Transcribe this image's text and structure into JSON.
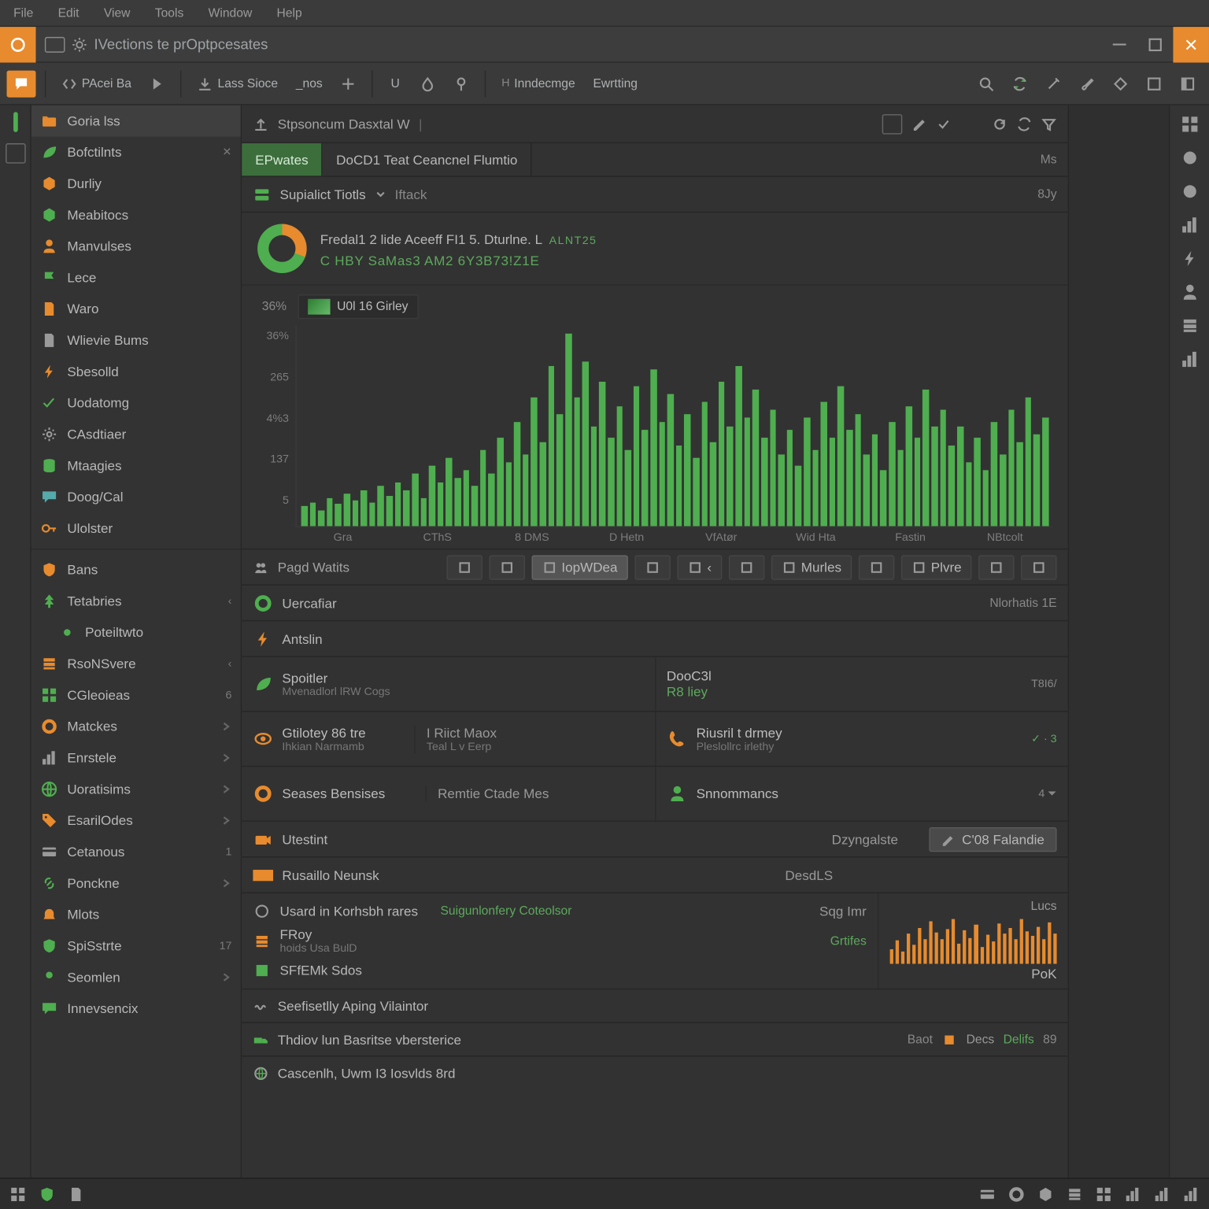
{
  "menubar": [
    "File",
    "Edit",
    "View",
    "Tools",
    "Window",
    "Help"
  ],
  "title": {
    "text": "IVections te prOptpcesates"
  },
  "toolbar": {
    "left": [
      {
        "icon": "bubble",
        "label": ""
      },
      {
        "icon": "code",
        "label": "PAcei Ba"
      },
      {
        "icon": "play",
        "label": ""
      }
    ],
    "mid": [
      {
        "icon": "download",
        "label": "Lass Sioce"
      },
      {
        "icon": "line",
        "label": "_nos"
      },
      {
        "icon": "plus",
        "label": ""
      }
    ],
    "mid2": [
      {
        "icon": "u",
        "label": "U"
      },
      {
        "icon": "drop",
        "label": ""
      },
      {
        "icon": "pin",
        "label": ""
      }
    ],
    "mid3": [
      {
        "label": "Inndecmge"
      },
      {
        "label": "Ewrtting"
      }
    ],
    "right": [
      "search",
      "sync",
      "wand",
      "brush",
      "diamond",
      "box",
      "panel"
    ]
  },
  "sidebar": [
    {
      "icon": "folder-o",
      "label": "Goria lss",
      "color": "c-orange",
      "active": true
    },
    {
      "icon": "leaf",
      "label": "Bofctilnts",
      "color": "c-green",
      "badge": "✕"
    },
    {
      "icon": "cube-o",
      "label": "Durliy",
      "color": "c-orange"
    },
    {
      "icon": "cube-g",
      "label": "Meabitocs",
      "color": "c-green"
    },
    {
      "icon": "person",
      "label": "Manvulses",
      "color": "c-orange"
    },
    {
      "icon": "flag",
      "label": "Lece",
      "color": "c-green"
    },
    {
      "icon": "doc-o",
      "label": "Waro",
      "color": "c-orange"
    },
    {
      "icon": "doc",
      "label": "Wlievie Bums",
      "color": "c-grey"
    },
    {
      "icon": "bolt",
      "label": "Sbesolld",
      "color": "c-orange"
    },
    {
      "icon": "check",
      "label": "Uodatomg",
      "color": "c-green"
    },
    {
      "icon": "gear",
      "label": "CAsdtiaer",
      "color": "c-grey"
    },
    {
      "icon": "db",
      "label": "Mtaagies",
      "color": "c-green"
    },
    {
      "icon": "chat",
      "label": "Doog/Cal",
      "color": "c-teal"
    },
    {
      "icon": "key",
      "label": "Ulolster",
      "color": "c-orange"
    },
    {
      "sep": true
    },
    {
      "icon": "shield-o",
      "label": "Bans",
      "color": "c-orange"
    },
    {
      "icon": "tree",
      "label": "Tetabries",
      "color": "c-green",
      "badge": "‹"
    },
    {
      "icon": "dot-g",
      "label": "Poteiltwto",
      "color": "c-green",
      "indent": true
    },
    {
      "icon": "stack",
      "label": "RsoNSvere",
      "color": "c-orange",
      "badge": "‹"
    },
    {
      "icon": "grid",
      "label": "CGleoieas",
      "color": "c-green",
      "badge": "6"
    },
    {
      "icon": "ring",
      "label": "Matckes",
      "color": "c-orange",
      "chev": true
    },
    {
      "icon": "bars",
      "label": "Enrstele",
      "color": "c-grey",
      "chev": true
    },
    {
      "icon": "globe-g",
      "label": "Uoratisims",
      "color": "c-green",
      "chev": true
    },
    {
      "icon": "tag",
      "label": "EsarilOdes",
      "color": "c-orange",
      "chev": true
    },
    {
      "icon": "card",
      "label": "Cetanous",
      "color": "c-grey",
      "badge": "1"
    },
    {
      "icon": "link",
      "label": "Ponckne",
      "color": "c-green",
      "chev": true
    },
    {
      "icon": "bell-o",
      "label": "Mlots",
      "color": "c-orange"
    },
    {
      "icon": "shield-g",
      "label": "SpiSstrte",
      "color": "c-green",
      "badge": "17"
    },
    {
      "icon": "pin-g",
      "label": "Seomlen",
      "color": "c-green",
      "chev": true
    },
    {
      "icon": "bubble-g",
      "label": "Innevsencix",
      "color": "c-green"
    }
  ],
  "rail_right": [
    "grid",
    "download",
    "export",
    "chart-dot",
    "bug",
    "person",
    "layers",
    "ruler"
  ],
  "content": {
    "head": {
      "title": "Stpsoncum Dasxtal W",
      "actions": [
        "box",
        "pen",
        "check",
        "refresh",
        "sync",
        "filter"
      ]
    },
    "tabs": [
      {
        "label": "EPwates",
        "active": true
      },
      {
        "label": "DoCD1 Teat Ceancnel Flumtio"
      }
    ],
    "tab_meta": "Ms",
    "panel_head": {
      "icon": "server",
      "label": "Supialict Tiotls",
      "sub": "Iftack",
      "meta": "8Jy"
    },
    "titleblock": {
      "title": "Fredal1 2 lide Aceeff FI1 5. Dturlne. L",
      "tag": "ALNT25",
      "sub": "C HBY SaMas3 AM2 6Y3B73!Z1E"
    },
    "legend": {
      "label": "U0l 16 Girley"
    },
    "y_top": "36%",
    "action_bar": {
      "left": {
        "icon": "users",
        "label": "Pagd Watits"
      },
      "buttons": [
        {
          "icon": "note",
          "label": ""
        },
        {
          "icon": "thumb",
          "label": ""
        },
        {
          "icon": "label",
          "label": "IopWDea",
          "primary": true
        },
        {
          "icon": "ring",
          "label": ""
        },
        {
          "icon": "back",
          "label": "‹"
        },
        {
          "icon": "box",
          "label": ""
        },
        {
          "icon": "flame",
          "label": "Murles"
        },
        {
          "icon": "tab",
          "label": ""
        },
        {
          "icon": "tag",
          "label": "Plvre"
        },
        {
          "icon": "eq",
          "label": ""
        },
        {
          "icon": "grid",
          "label": ""
        }
      ]
    },
    "rows": [
      {
        "icon": "ring-g",
        "t": "Uercafiar",
        "meta": "Nlorhatis 1E"
      },
      {
        "icon": "bolt-o",
        "t": "Antslin"
      }
    ],
    "grid": [
      [
        {
          "icon": "leaf-g",
          "t1": "Spoitler",
          "t2": "Mvenadlorl lRW Cogs"
        },
        {
          "t1": "DooC3l",
          "t2": "R8 liey",
          "t2c": "green",
          "badge": "T8I6/"
        }
      ],
      [
        {
          "icon": "eye-o",
          "t1": "Gtilotey 86 tre",
          "t2": "Ihkian Narmamb",
          "mid": "I Riict Maox",
          "mid2": "Teal L v Eerp"
        },
        {
          "icon": "phone-o",
          "t1": "Riusril t drmey",
          "t2": "Pleslollrc irlethy",
          "badge": "✓  ·  3"
        }
      ],
      [
        {
          "icon": "ring-o",
          "t1": "Seases Bensises",
          "mid": "Remtie Ctade Mes"
        },
        {
          "icon": "user-g",
          "t1": "Snnommancs",
          "badge": "4 ⏷"
        }
      ]
    ],
    "rows2": [
      {
        "icon": "cam-o",
        "t": "Utestint",
        "r": "Dzyngalste",
        "btn": {
          "icon": "pen",
          "label": "C'08  Falandie"
        }
      },
      {
        "icon": "bar-o",
        "t": "Rusaillo Neunsk",
        "r": "DesdLS"
      }
    ],
    "mini": {
      "head": {
        "icon": "ring",
        "t": "Usard in Korhsbh rares",
        "link": "Suigunlonfery Coteolsor",
        "r": "Sqg Imr",
        "rr": "Lucs"
      },
      "items": [
        {
          "icon": "stack-o",
          "t": "FRoy",
          "sub": "hoids Usa BulD",
          "link": "Grtifes"
        },
        {
          "icon": "block-g",
          "t": "SFfEMk Sdos"
        }
      ],
      "rmeta": {
        "a": "",
        "b": "PoK"
      }
    },
    "foot": [
      {
        "icon": "wave",
        "t": "Seefisetlly Aping Vilaintor"
      },
      {
        "icon": "truck",
        "t": "Thdiov lun Basritse vbersterice",
        "r1": "Baot",
        "ricon": "box-o",
        "r2": "Decs",
        "link": "Delifs",
        "end": "89"
      },
      {
        "icon": "globe",
        "t": "Cascenlh, Uwm I3 Iosvlds 8rd"
      }
    ]
  },
  "status_icons": [
    "cpu",
    "shield",
    "term",
    "box",
    "ring",
    "cube",
    "layers",
    "grid",
    "sliders",
    "col",
    "chart"
  ],
  "chart_data": {
    "type": "bar",
    "title": "U0l 16 Girley",
    "ylabel": "",
    "y_ticks": [
      "36%",
      "265",
      "4%3",
      "137",
      "5"
    ],
    "ylim": [
      0,
      100
    ],
    "categories": [
      "Gra",
      "CThS",
      "8 DMS",
      "D Hetn",
      "VfAtør",
      "Wid Hta",
      "Fastin",
      "NBtcolt"
    ],
    "values": [
      10,
      12,
      8,
      14,
      11,
      16,
      13,
      18,
      12,
      20,
      15,
      22,
      18,
      26,
      14,
      30,
      22,
      34,
      24,
      28,
      20,
      38,
      26,
      44,
      32,
      52,
      36,
      64,
      42,
      80,
      56,
      96,
      64,
      82,
      50,
      72,
      44,
      60,
      38,
      70,
      48,
      78,
      52,
      66,
      40,
      56,
      34,
      62,
      42,
      72,
      50,
      80,
      54,
      68,
      44,
      58,
      36,
      48,
      30,
      54,
      38,
      62,
      44,
      70,
      48,
      56,
      36,
      46,
      28,
      52,
      38,
      60,
      44,
      68,
      50,
      58,
      40,
      50,
      32,
      44,
      28,
      52,
      36,
      58,
      42,
      64,
      46,
      54
    ],
    "mini_values": [
      30,
      46,
      24,
      60,
      38,
      72,
      50,
      84,
      62,
      48,
      70,
      90,
      40,
      66,
      52,
      78,
      34,
      58,
      44,
      80,
      60,
      72,
      50,
      88,
      64,
      56,
      74,
      48,
      82,
      60
    ]
  }
}
